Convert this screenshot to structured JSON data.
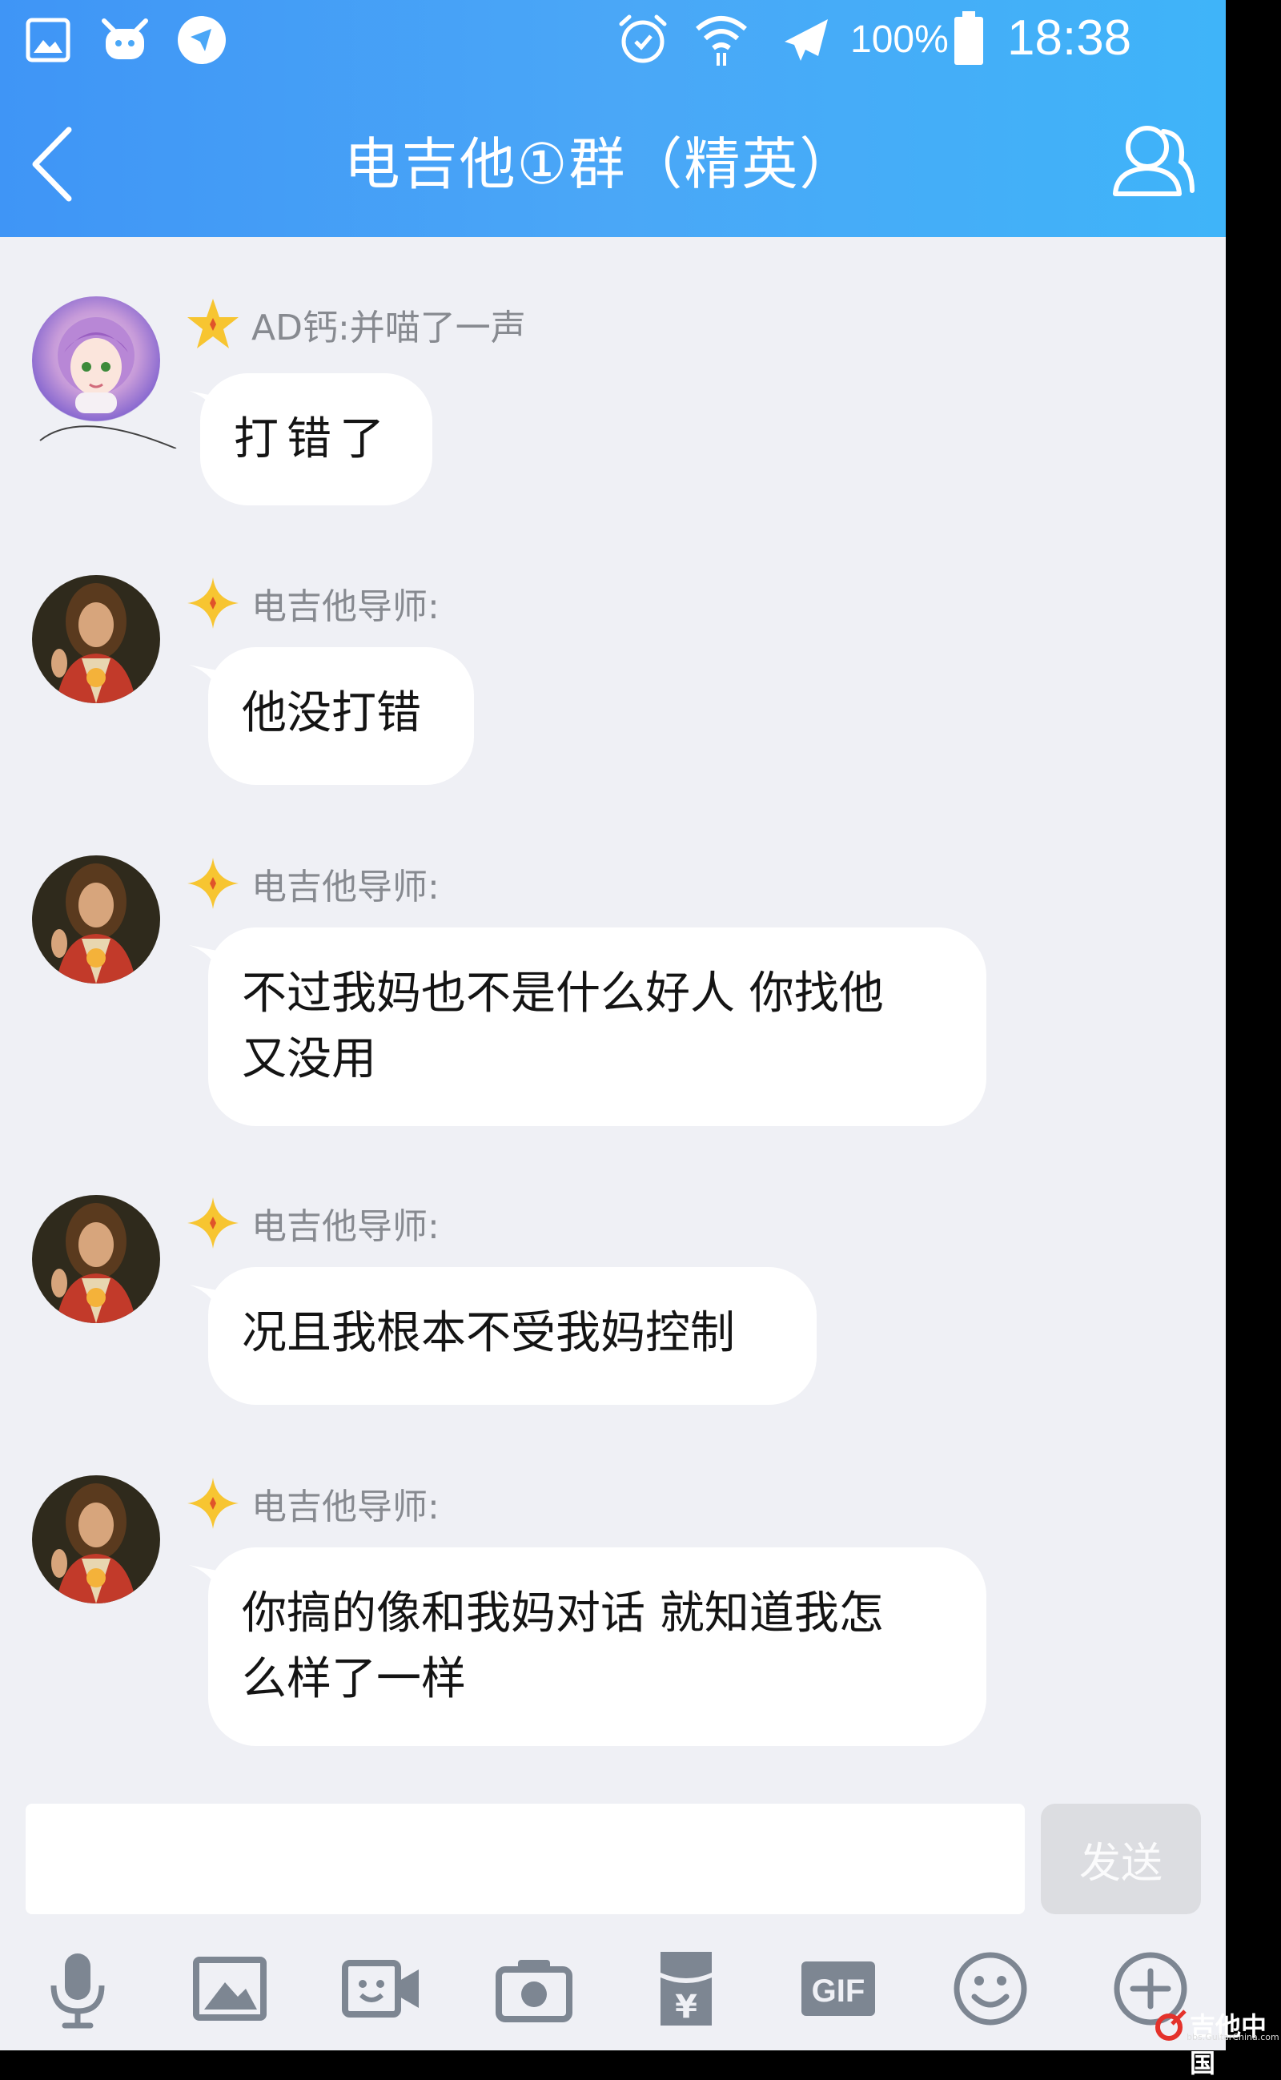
{
  "status_bar": {
    "battery_percent": "100%",
    "time": "18:38"
  },
  "header": {
    "title": "电吉他①群（精英）"
  },
  "messages": [
    {
      "sender": "AD钙:并喵了一声",
      "text": "打错了",
      "avatar": "anime-girl"
    },
    {
      "sender": "电吉他导师:",
      "text": "他没打错",
      "avatar": "portrait"
    },
    {
      "sender": "电吉他导师:",
      "text": "不过我妈也不是什么好人  你找他又没用",
      "avatar": "portrait"
    },
    {
      "sender": "电吉他导师:",
      "text": "况且我根本不受我妈控制",
      "avatar": "portrait"
    },
    {
      "sender": "电吉他导师:",
      "text": "你搞的像和我妈对话  就知道我怎么样了一样",
      "avatar": "portrait"
    }
  ],
  "input": {
    "value": "",
    "send_label": "发送"
  },
  "toolbar": {
    "items": [
      "mic-icon",
      "image-icon",
      "video-call-icon",
      "camera-icon",
      "red-packet-icon",
      "gif-icon",
      "emoji-icon",
      "plus-icon"
    ],
    "gif_label": "GIF",
    "yuan_label": "¥"
  },
  "watermark": {
    "main": "吉他中国",
    "sub": "bbs.GuitarChina.com"
  },
  "colors": {
    "header_start": "#3f95f6",
    "header_end": "#3fb4f9",
    "chat_background": "#eff0f5",
    "bubble": "#ffffff",
    "badge_gold": "#f7c531"
  }
}
